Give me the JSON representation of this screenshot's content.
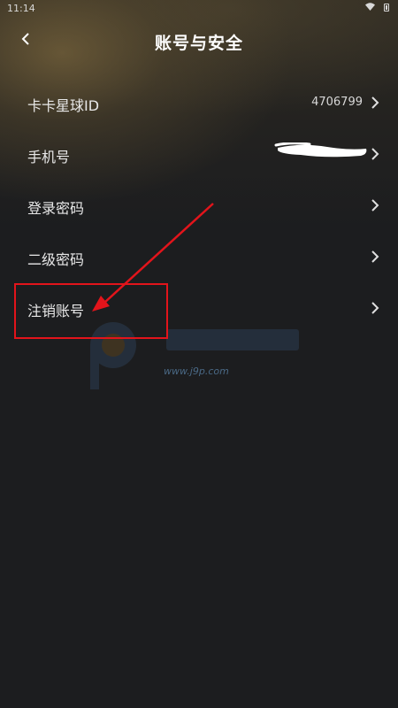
{
  "status_bar": {
    "time": "11:14"
  },
  "header": {
    "title": "账号与安全"
  },
  "rows": [
    {
      "label": "卡卡星球ID",
      "value": "4706799"
    },
    {
      "label": "手机号",
      "value": ""
    },
    {
      "label": "登录密码",
      "value": ""
    },
    {
      "label": "二级密码",
      "value": ""
    },
    {
      "label": "注销账号",
      "value": ""
    }
  ],
  "watermark": {
    "url": "www.j9p.com"
  },
  "colors": {
    "background": "#1c1d1f",
    "annotation_red": "#e2141b",
    "text": "#e8e8e8"
  },
  "icons": {
    "back": "chevron-left-icon",
    "row_arrow": "chevron-right-icon",
    "wifi": "wifi-icon",
    "battery": "battery-icon"
  }
}
